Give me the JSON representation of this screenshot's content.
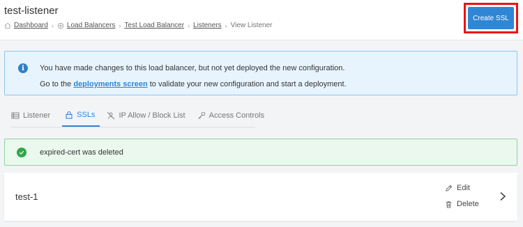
{
  "header": {
    "title": "test-listener",
    "breadcrumb": {
      "dashboard": "Dashboard",
      "load_balancers": "Load Balancers",
      "load_balancer": "Test Load Balancer",
      "listeners": "Listeners",
      "current": "View Listener"
    },
    "create_button": "Create SSL"
  },
  "info_alert": {
    "line1": "You have made changes to this load balancer, but not yet deployed the new configuration.",
    "line2_prefix": "Go to the ",
    "link": "deployments screen",
    "line2_suffix": " to validate your new configuration and start a deployment."
  },
  "tabs": [
    {
      "label": "Listener",
      "icon": "list-icon"
    },
    {
      "label": "SSLs",
      "icon": "lock-icon",
      "active": true
    },
    {
      "label": "IP Allow / Block List",
      "icon": "user-slash-icon"
    },
    {
      "label": "Access Controls",
      "icon": "key-icon"
    }
  ],
  "success_alert": {
    "message": "expired-cert was deleted"
  },
  "ssl_item": {
    "name": "test-1",
    "edit": "Edit",
    "delete": "Delete"
  },
  "colors": {
    "primary": "#2f86d4",
    "info_bg": "#e8f4fd",
    "success_bg": "#ebf8ee",
    "success": "#2da84a",
    "highlight": "#ee1111"
  }
}
